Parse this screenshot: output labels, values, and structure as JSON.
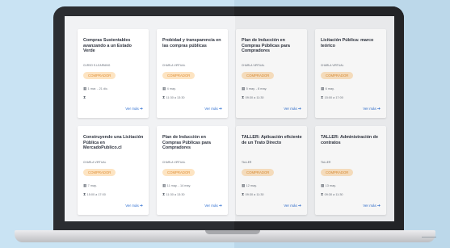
{
  "courses": [
    {
      "title": "Compras Sustentables avanzando a un Estado Verde",
      "type": "CURSO E-LEARNING",
      "badge": "COMPRADOR",
      "date": "1 mar. - 21 dic.",
      "time": "",
      "more": "Ver más"
    },
    {
      "title": "Probidad y transparencia en las compras públicas",
      "type": "CHARLA VIRTUAL",
      "badge": "COMPRADOR",
      "date": "4 may.",
      "time": "11:30 a 13:30",
      "more": "Ver más"
    },
    {
      "title": "Plan de Inducción en Compras Públicas para Compradores",
      "type": "CHARLA VIRTUAL",
      "badge": "COMPRADOR",
      "date": "5 may. - 8 may.",
      "time": "09:30 a 11:30",
      "more": "Ver más"
    },
    {
      "title": "Licitación Pública: marco teórico",
      "type": "CHARLA VIRTUAL",
      "badge": "COMPRADOR",
      "date": "6 may.",
      "time": "15:00 a 17:00",
      "more": "Ver más"
    },
    {
      "title": "Construyendo una Licitación Pública en MercadoPublico.cl",
      "type": "CHARLA VIRTUAL",
      "badge": "COMPRADOR",
      "date": "7 may.",
      "time": "15:00 a 17:00",
      "more": "Ver más"
    },
    {
      "title": "Plan de Inducción en Compras Públicas para Compradores",
      "type": "CHARLA VIRTUAL",
      "badge": "COMPRADOR",
      "date": "11 may. - 14 may.",
      "time": "11:30 a 13:30",
      "more": "Ver más"
    },
    {
      "title": "TALLER: Aplicación eficiente de un Trato Directo",
      "type": "TALLER",
      "badge": "COMPRADOR",
      "date": "12 may.",
      "time": "09:30 a 11:30",
      "more": "Ver más"
    },
    {
      "title": "TALLER: Administración de contratos",
      "type": "TALLER",
      "badge": "COMPRADOR",
      "date": "13 may.",
      "time": "09:30 a 11:30",
      "more": "Ver más"
    }
  ],
  "icons": {
    "calendar": "calendar-icon",
    "clock": "hourglass-icon",
    "arrow": "arrow-right-icon"
  },
  "colors": {
    "badge_text": "#e0913a",
    "badge_bg": "#fde4c2",
    "link": "#2f6fd1",
    "background": "#c9e3f3"
  }
}
